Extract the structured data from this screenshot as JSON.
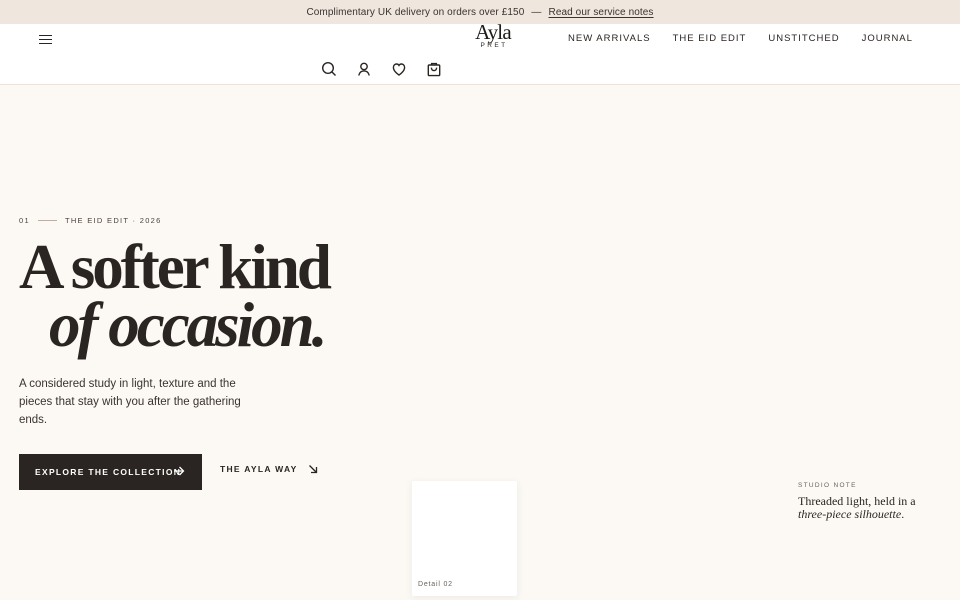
{
  "announcement": {
    "text": "Complimentary UK delivery on orders over £150",
    "separator": "—",
    "link": "Read our service notes"
  },
  "header": {
    "menu_icon": "hamburger-icon",
    "logo": {
      "word": "Ayla",
      "sub": "PRET"
    },
    "nav": [
      "NEW ARRIVALS",
      "THE EID EDIT",
      "UNSTITCHED",
      "JOURNAL"
    ],
    "icons": [
      "search-icon",
      "account-icon",
      "heart-icon",
      "bag-icon"
    ]
  },
  "hero": {
    "eyebrow_index": "01",
    "eyebrow_label": "THE EID EDIT · 2026",
    "headline_line1": "A softer kind",
    "headline_line2": "of occasion.",
    "lede": "A considered study in light, texture and the pieces that stay with you after the gathering ends.",
    "primary_cta": "EXPLORE THE COLLECTION",
    "secondary_cta": "THE AYLA WAY"
  },
  "detail_card": {
    "label": "Detail 02"
  },
  "studio_note": {
    "kicker": "STUDIO NOTE",
    "text_part1": "Threaded light, held in a ",
    "text_emphasis": "three-piece silhouette",
    "text_end": "."
  },
  "colors": {
    "background": "#fcf9f4",
    "announcement_bar": "#efe6dd",
    "ink": "#2a2522",
    "button": "#2a2522"
  }
}
